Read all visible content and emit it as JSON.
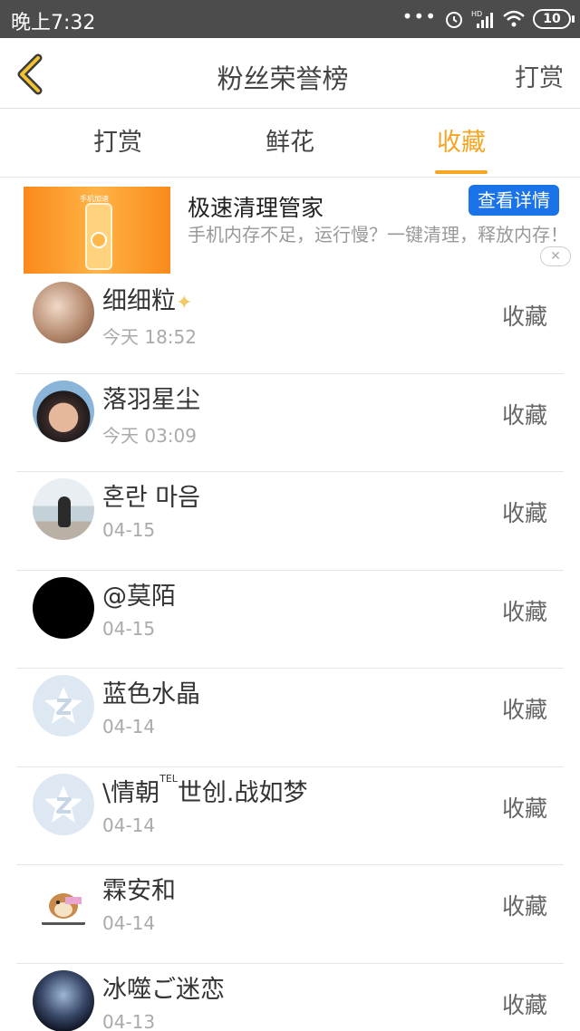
{
  "status_bar": {
    "time": "晚上7:32",
    "dots": "•••",
    "battery": "10"
  },
  "header": {
    "title": "粉丝荣誉榜",
    "action_label": "打赏"
  },
  "tabs": [
    {
      "label": "打赏",
      "active": false
    },
    {
      "label": "鲜花",
      "active": false
    },
    {
      "label": "收藏",
      "active": true
    }
  ],
  "ad": {
    "title": "极速清理管家",
    "button": "查看详情",
    "description": "手机内存不足，运行慢？一键清理，释放内存！",
    "thumb_caption": "手机加速",
    "close": "✕"
  },
  "list": [
    {
      "name": "细细粒",
      "time": "今天 18:52",
      "action": "收藏"
    },
    {
      "name": "落羽星尘",
      "time": "今天 03:09",
      "action": "收藏"
    },
    {
      "name": "혼란 마음",
      "time": "04-15",
      "action": "收藏"
    },
    {
      "name": "@莫陌",
      "time": "04-15",
      "action": "收藏"
    },
    {
      "name": "蓝色水晶",
      "time": "04-14",
      "action": "收藏"
    },
    {
      "name_prefix": "\\情朝",
      "name_sup": "TEL",
      "name_suffix": "世创.战如梦",
      "time": "04-14",
      "action": "收藏"
    },
    {
      "name": "霖安和",
      "time": "04-14",
      "action": "收藏"
    },
    {
      "name": "冰噬ご迷恋",
      "time": "04-13",
      "action": "收藏"
    }
  ],
  "colors": {
    "accent": "#f5a623",
    "ad_button": "#1a73e8",
    "status_bar": "#4c4c4c"
  }
}
